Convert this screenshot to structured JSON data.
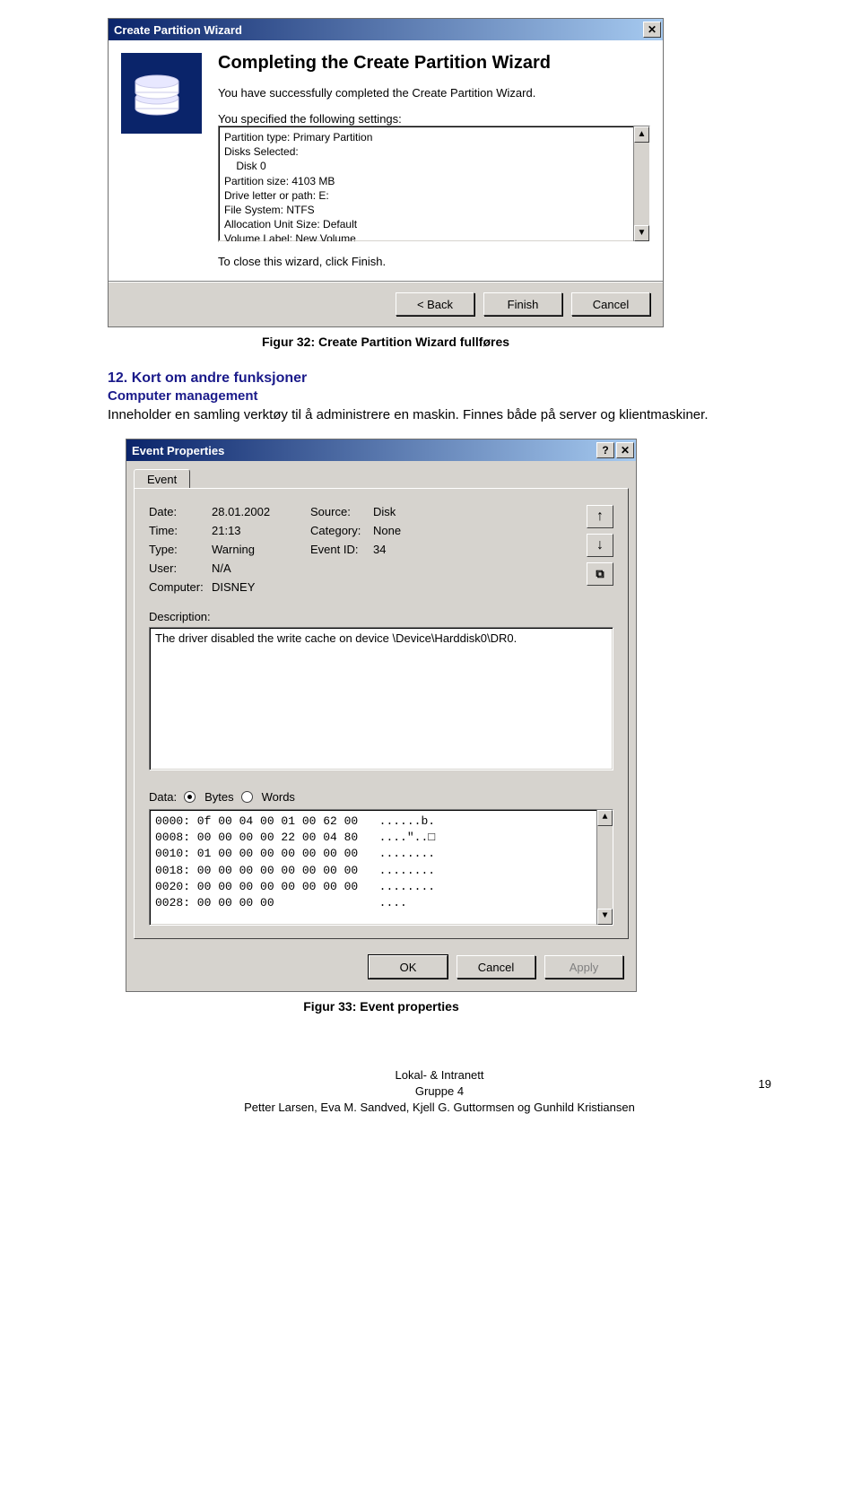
{
  "wizard": {
    "title": "Create Partition Wizard",
    "heading": "Completing the Create Partition Wizard",
    "intro": "You have successfully completed the Create Partition Wizard.",
    "settings_label": "You specified the following settings:",
    "settings_lines": [
      "Partition type: Primary Partition",
      "Disks Selected:",
      "    Disk 0",
      "Partition size: 4103 MB",
      "Drive letter or path: E:",
      "File System: NTFS",
      "Allocation Unit Size: Default",
      "Volume Label: New Volume"
    ],
    "close_text": "To close this wizard, click Finish.",
    "buttons": {
      "back": "< Back",
      "finish": "Finish",
      "cancel": "Cancel"
    }
  },
  "caption1": "Figur 32: Create Partition Wizard fullføres",
  "section": {
    "num": "12.",
    "title": "Kort om andre funksjoner",
    "subhead": "Computer management",
    "body": "Inneholder en samling verktøy til å administrere en maskin. Finnes både på server og klientmaskiner."
  },
  "event": {
    "title": "Event Properties",
    "tab": "Event",
    "fields": {
      "date_label": "Date:",
      "date": "28.01.2002",
      "source_label": "Source:",
      "source": "Disk",
      "time_label": "Time:",
      "time": "21:13",
      "category_label": "Category:",
      "category": "None",
      "type_label": "Type:",
      "type": "Warning",
      "eventid_label": "Event ID:",
      "eventid": "34",
      "user_label": "User:",
      "user": "N/A",
      "computer_label": "Computer:",
      "computer": "DISNEY"
    },
    "description_label": "Description:",
    "description": "The driver disabled the write cache on device \\Device\\Harddisk0\\DR0.",
    "data_label": "Data:",
    "radio_bytes": "Bytes",
    "radio_words": "Words",
    "data_dump": "0000: 0f 00 04 00 01 00 62 00   ......b.\n0008: 00 00 00 00 22 00 04 80   ....\"..□\n0010: 01 00 00 00 00 00 00 00   ........\n0018: 00 00 00 00 00 00 00 00   ........\n0020: 00 00 00 00 00 00 00 00   ........\n0028: 00 00 00 00               ....",
    "buttons": {
      "ok": "OK",
      "cancel": "Cancel",
      "apply": "Apply"
    }
  },
  "caption2": "Figur 33: Event properties",
  "footer": {
    "line1": "Lokal- & Intranett",
    "line2": "Gruppe 4",
    "line3": "Petter Larsen, Eva M. Sandved, Kjell G. Guttormsen og Gunhild Kristiansen",
    "page": "19"
  }
}
